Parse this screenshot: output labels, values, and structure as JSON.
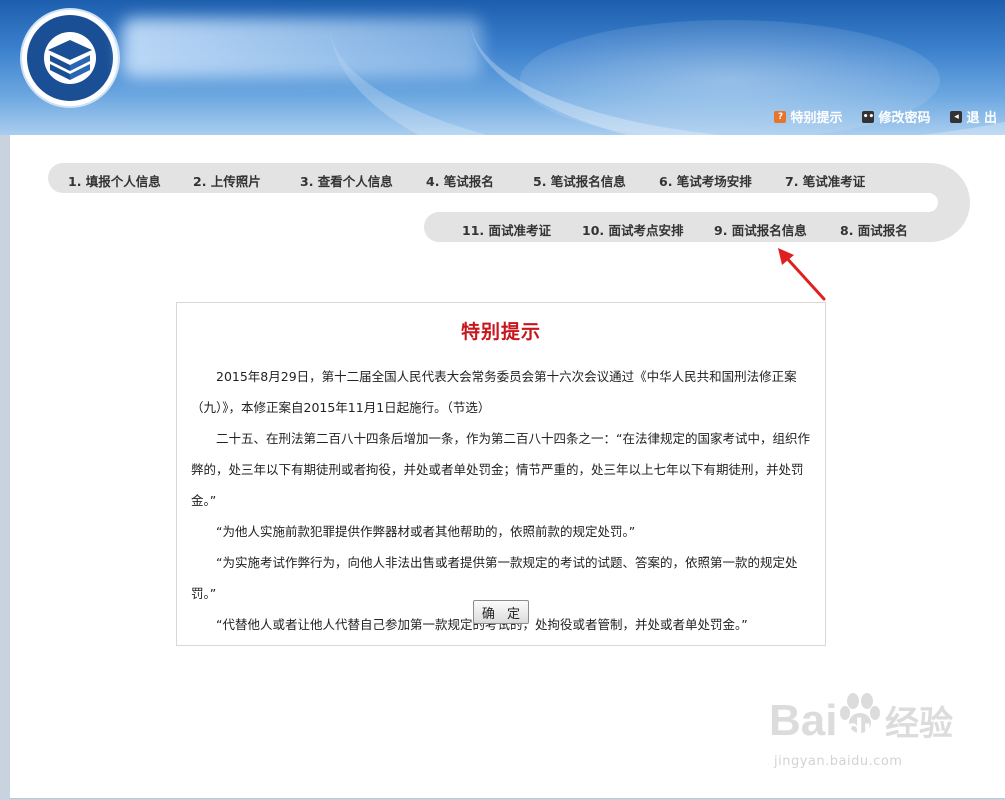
{
  "header": {
    "logo_alt_text": "教师资格考试 National Teacher Certification Examination",
    "links": [
      {
        "label": "特别提示",
        "icon": "notice-icon",
        "glyph": "?"
      },
      {
        "label": "修改密码",
        "icon": "password-icon",
        "glyph": "••"
      },
      {
        "label": "退 出",
        "icon": "exit-icon",
        "glyph": "◂"
      }
    ]
  },
  "steps": {
    "row1": [
      "1. 填报个人信息",
      "2. 上传照片",
      "3. 查看个人信息",
      "4. 笔试报名",
      "5. 笔试报名信息",
      "6. 笔试考场安排",
      "7. 笔试准考证"
    ],
    "row2": [
      "11. 面试准考证",
      "10. 面试考点安排",
      "9. 面试报名信息",
      "8. 面试报名"
    ]
  },
  "notice": {
    "title": "特别提示",
    "paragraphs": [
      "2015年8月29日，第十二届全国人民代表大会常务委员会第十六次会议通过《中华人民共和国刑法修正案（九）》，本修正案自2015年11月1日起施行。（节选）",
      "二十五、在刑法第二百八十四条后增加一条，作为第二百八十四条之一：“在法律规定的国家考试中，组织作弊的，处三年以下有期徒刑或者拘役，并处或者单处罚金；情节严重的，处三年以上七年以下有期徒刑，并处罚金。”",
      "“为他人实施前款犯罪提供作弊器材或者其他帮助的，依照前款的规定处罚。”",
      "“为实施考试作弊行为，向他人非法出售或者提供第一款规定的考试的试题、答案的，依照第一款的规定处罚。”",
      "“代替他人或者让他人代替自己参加第一款规定的考试的，处拘役或者管制，并处或者单处罚金。”"
    ],
    "confirm_label": "确 定"
  },
  "watermark": {
    "brand": "Bai",
    "brand2": "du",
    "cn": "经验",
    "url": "jingyan.baidu.com"
  }
}
